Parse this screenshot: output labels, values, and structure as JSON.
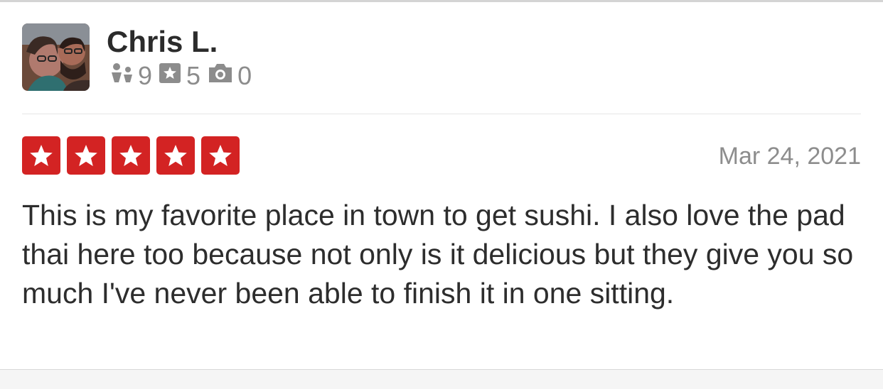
{
  "reviewer": {
    "name": "Chris L.",
    "stats": [
      {
        "icon": "friends-icon",
        "count": "9"
      },
      {
        "icon": "review-star-icon",
        "count": "5"
      },
      {
        "icon": "camera-icon",
        "count": "0"
      }
    ]
  },
  "review": {
    "rating": 5,
    "date": "Mar 24, 2021",
    "text": "This is my favorite place in town to get sushi. I also love the pad thai here too because not only is it delicious but they give you so much I've never been able to finish it in one sitting."
  },
  "colors": {
    "star_red": "#d32323",
    "muted_text": "#8d8d8d",
    "body_text": "#2d2d2d"
  }
}
